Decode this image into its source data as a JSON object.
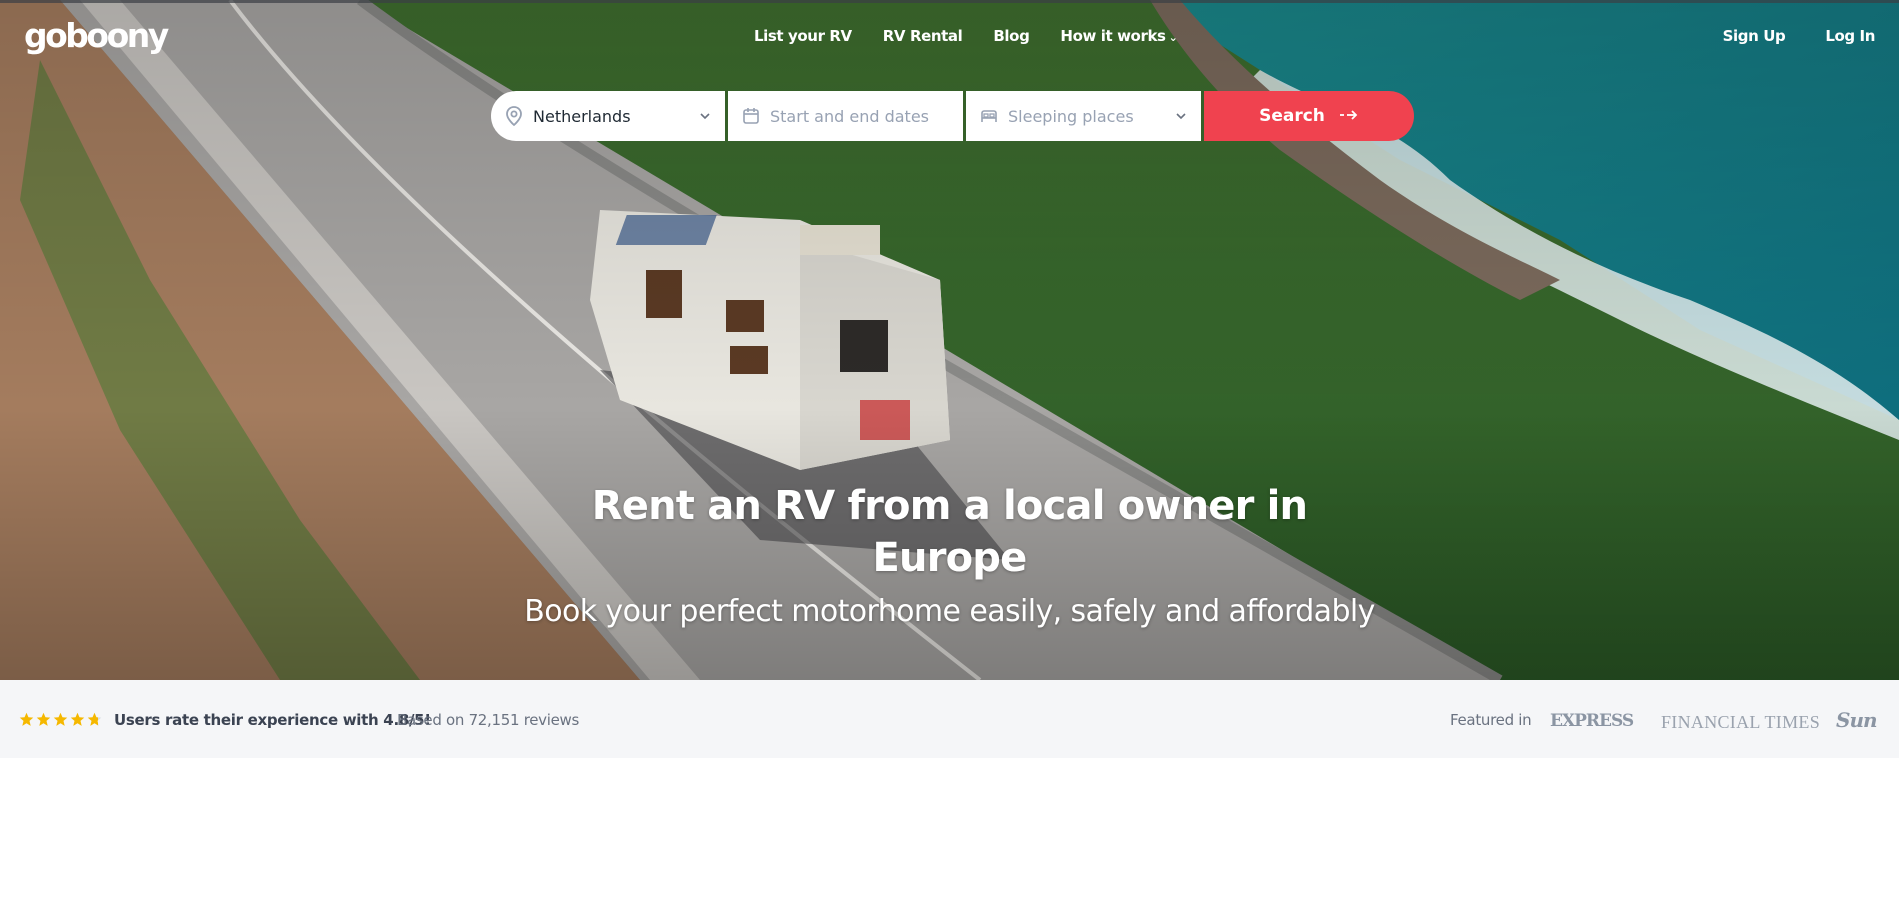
{
  "header": {
    "logo_text": "goboony",
    "nav": [
      {
        "label": "List your RV"
      },
      {
        "label": "RV Rental"
      },
      {
        "label": "Blog"
      },
      {
        "label": "How it works"
      }
    ],
    "sign_up": "Sign Up",
    "log_in": "Log In"
  },
  "search": {
    "location_value": "Netherlands",
    "dates_placeholder": "Start and end dates",
    "sleeping_placeholder": "Sleeping places",
    "button_label": "Search",
    "location_icon": "map-pin-icon",
    "calendar_icon": "calendar-icon",
    "sleeping_icon": "bed-icon",
    "arrow_icon": "arrow-right-icon"
  },
  "hero": {
    "title": "Rent an RV from a local owner in Europe",
    "subtitle": "Book your perfect motorhome easily, safely and affordably"
  },
  "ratings": {
    "stars": 4.8,
    "text": "Users rate their experience with 4.8/5!",
    "reviews": "Based on 72,151 reviews"
  },
  "featured": {
    "label": "Featured in",
    "logos": [
      "EXPRESS",
      "FINANCIAL TIMES",
      "Sun"
    ]
  },
  "colors": {
    "accent": "#f0424f",
    "star": "#f5b800",
    "strip_bg": "#f5f6f8"
  }
}
